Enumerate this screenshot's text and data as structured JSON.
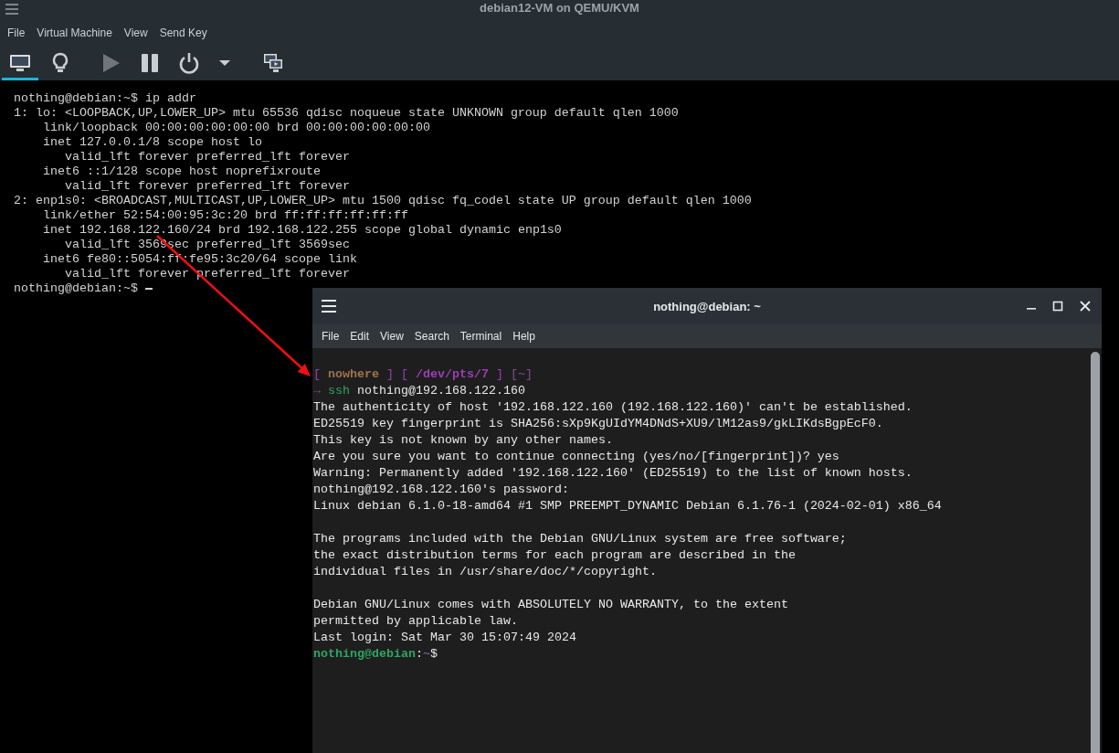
{
  "window": {
    "title": "debian12-VM on QEMU/KVM"
  },
  "menu": [
    {
      "label": "File"
    },
    {
      "label": "Virtual Machine"
    },
    {
      "label": "View"
    },
    {
      "label": "Send Key"
    }
  ],
  "toolbar": [
    {
      "kind": "console",
      "selected": true,
      "disabled": false
    },
    {
      "kind": "details",
      "selected": false,
      "disabled": false
    },
    {
      "kind": "run",
      "selected": false,
      "disabled": true
    },
    {
      "kind": "pause",
      "selected": false,
      "disabled": false
    },
    {
      "kind": "power",
      "selected": false,
      "disabled": false
    },
    {
      "kind": "dropdown",
      "selected": false,
      "disabled": false
    },
    {
      "kind": "fullscreen",
      "selected": false,
      "disabled": false
    }
  ],
  "console": {
    "lines": [
      {
        "text": "nothing@debian:~$ ip addr"
      },
      {
        "text": "1: lo: <LOOPBACK,UP,LOWER_UP> mtu 65536 qdisc noqueue state UNKNOWN group default qlen 1000",
        "children": [
          {
            "text": "link/loopback 00:00:00:00:00:00 brd 00:00:00:00:00:00"
          },
          {
            "text": "inet 127.0.0.1/8 scope host lo",
            "children": [
              {
                "text": "valid_lft forever preferred_lft forever"
              }
            ]
          },
          {
            "text": "inet6 ::1/128 scope host noprefixroute",
            "children": [
              {
                "text": "valid_lft forever preferred_lft forever"
              }
            ]
          }
        ]
      },
      {
        "text": "2: enp1s0: <BROADCAST,MULTICAST,UP,LOWER_UP> mtu 1500 qdisc fq_codel state UP group default qlen 1000",
        "children": [
          {
            "text": "link/ether 52:54:00:95:3c:20 brd ff:ff:ff:ff:ff:ff"
          },
          {
            "text": "inet 192.168.122.160/24 brd 192.168.122.255 scope global dynamic enp1s0",
            "children": [
              {
                "text": "valid_lft 3569sec preferred_lft 3569sec"
              }
            ]
          },
          {
            "text": "inet6 fe80::5054:ff:fe95:3c20/64 scope link",
            "children": [
              {
                "text": "valid_lft forever preferred_lft forever"
              }
            ]
          }
        ]
      },
      {
        "text": "nothing@debian:~$"
      }
    ]
  },
  "terminal": {
    "title": "nothing@debian: ~",
    "menu": [
      {
        "label": "File"
      },
      {
        "label": "Edit"
      },
      {
        "label": "View"
      },
      {
        "label": "Search"
      },
      {
        "label": "Terminal"
      },
      {
        "label": "Help"
      }
    ],
    "blocks": [
      {
        "lines": [
          {
            "segments": [
              {
                "kind": "bracket",
                "text": "["
              },
              {
                "kind": "host",
                "text": " nowhere "
              },
              {
                "kind": "bracket",
                "text": "] ["
              },
              {
                "kind": "path",
                "text": " /dev/pts/7 "
              },
              {
                "kind": "bracket",
                "text": "] "
              },
              {
                "kind": "dim",
                "text": "[~]"
              }
            ]
          },
          {
            "segments": [
              {
                "kind": "dim",
                "text": "→ "
              },
              {
                "kind": "command",
                "text": "ssh"
              },
              {
                "kind": "plain",
                "text": " nothing@192.168.122.160"
              }
            ]
          },
          {
            "segments": [
              {
                "kind": "plain",
                "text": "The authenticity of host '192.168.122.160 (192.168.122.160)' can't be established."
              }
            ]
          },
          {
            "segments": [
              {
                "kind": "plain",
                "text": "ED25519 key fingerprint is SHA256:sXp9KgUIdYM4DNdS+XU9/lM12as9/gkLIKdsBgpEcF0."
              }
            ]
          },
          {
            "segments": [
              {
                "kind": "plain",
                "text": "This key is not known by any other names."
              }
            ]
          },
          {
            "segments": [
              {
                "kind": "plain",
                "text": "Are you sure you want to continue connecting (yes/no/[fingerprint])? yes"
              }
            ]
          },
          {
            "segments": [
              {
                "kind": "plain",
                "text": "Warning: Permanently added '192.168.122.160' (ED25519) to the list of known hosts."
              }
            ]
          },
          {
            "segments": [
              {
                "kind": "plain",
                "text": "nothing@192.168.122.160's password:"
              }
            ]
          },
          {
            "segments": [
              {
                "kind": "plain",
                "text": "Linux debian 6.1.0-18-amd64 #1 SMP PREEMPT_DYNAMIC Debian 6.1.76-1 (2024-02-01) x86_64"
              }
            ]
          }
        ]
      },
      {
        "lines": [
          {
            "segments": [
              {
                "kind": "plain",
                "text": "The programs included with the Debian GNU/Linux system are free software;"
              }
            ]
          },
          {
            "segments": [
              {
                "kind": "plain",
                "text": "the exact distribution terms for each program are described in the"
              }
            ]
          },
          {
            "segments": [
              {
                "kind": "plain",
                "text": "individual files in /usr/share/doc/*/copyright."
              }
            ]
          }
        ]
      },
      {
        "lines": [
          {
            "segments": [
              {
                "kind": "plain",
                "text": "Debian GNU/Linux comes with ABSOLUTELY NO WARRANTY, to the extent"
              }
            ]
          },
          {
            "segments": [
              {
                "kind": "plain",
                "text": "permitted by applicable law."
              }
            ]
          },
          {
            "segments": [
              {
                "kind": "plain",
                "text": "Last login: Sat Mar 30 15:07:49 2024"
              }
            ]
          },
          {
            "segments": [
              {
                "kind": "user",
                "text": "nothing@debian"
              },
              {
                "kind": "plain",
                "text": ":"
              },
              {
                "kind": "dir",
                "text": "~"
              },
              {
                "kind": "plain",
                "text": "$"
              }
            ]
          }
        ]
      }
    ]
  }
}
